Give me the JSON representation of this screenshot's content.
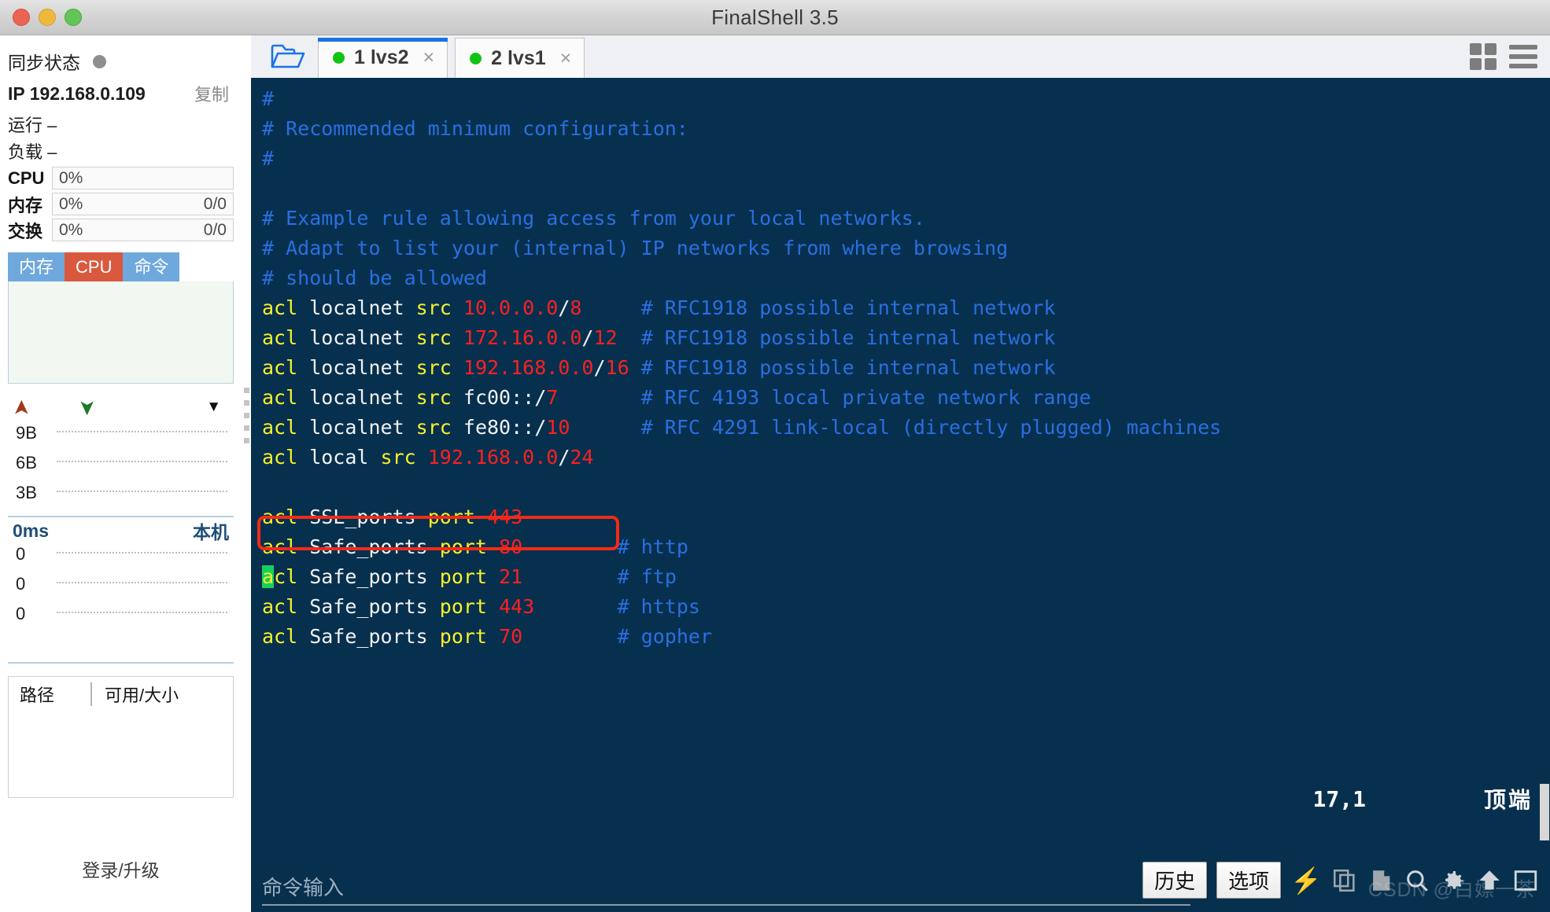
{
  "window": {
    "title": "FinalShell 3.5",
    "traffic_lights": [
      "close",
      "minimize",
      "maximize"
    ]
  },
  "sidebar": {
    "sync_status_label": "同步状态",
    "ip_label": "IP 192.168.0.109",
    "copy_label": "复制",
    "uptime_label": "运行 –",
    "load_label": "负载 –",
    "meters": [
      {
        "name": "CPU",
        "value": "0%",
        "right": ""
      },
      {
        "name": "内存",
        "value": "0%",
        "right": "0/0"
      },
      {
        "name": "交换",
        "value": "0%",
        "right": "0/0"
      }
    ],
    "mini_tabs": [
      {
        "label": "内存",
        "active": false
      },
      {
        "label": "CPU",
        "active": true
      },
      {
        "label": "命令",
        "active": false
      }
    ],
    "net_graph": {
      "upload_icon": "arrow-up",
      "download_icon": "arrow-down",
      "ticks": [
        "9B",
        "6B",
        "3B"
      ]
    },
    "ping_graph": {
      "latency": "0ms",
      "host_label": "本机",
      "ticks": [
        "0",
        "0",
        "0"
      ]
    },
    "disk_panel": {
      "col_path": "路径",
      "col_avail": "可用/大小"
    },
    "login_label": "登录/升级"
  },
  "tabs": {
    "folder_icon": "open-folder-icon",
    "items": [
      {
        "label": "1 lvs2",
        "active": true,
        "status": "connected"
      },
      {
        "label": "2 lvs1",
        "active": false,
        "status": "connected"
      }
    ],
    "close_glyph": "×"
  },
  "top_right": {
    "grid_icon": "grid-view-icon",
    "menu_icon": "hamburger-menu-icon"
  },
  "terminal": {
    "lines": [
      [
        {
          "t": "#",
          "c": "cmt"
        }
      ],
      [
        {
          "t": "# Recommended minimum configuration:",
          "c": "cmt"
        }
      ],
      [
        {
          "t": "#",
          "c": "cmt"
        }
      ],
      [
        {
          "t": "",
          "c": "cmt"
        }
      ],
      [
        {
          "t": "# Example rule allowing access from your local networks.",
          "c": "cmt"
        }
      ],
      [
        {
          "t": "# Adapt to list your (internal) IP networks from where browsing",
          "c": "cmt"
        }
      ],
      [
        {
          "t": "# should be allowed",
          "c": "cmt"
        }
      ],
      [
        {
          "t": "acl",
          "c": "key"
        },
        {
          "t": " localnet ",
          "c": "wht"
        },
        {
          "t": "src",
          "c": "key"
        },
        {
          "t": " ",
          "c": "wht"
        },
        {
          "t": "10.0.0.0",
          "c": "num"
        },
        {
          "t": "/",
          "c": "wht"
        },
        {
          "t": "8",
          "c": "num"
        },
        {
          "t": "     ",
          "c": "wht"
        },
        {
          "t": "# RFC1918 possible internal network",
          "c": "cmt"
        }
      ],
      [
        {
          "t": "acl",
          "c": "key"
        },
        {
          "t": " localnet ",
          "c": "wht"
        },
        {
          "t": "src",
          "c": "key"
        },
        {
          "t": " ",
          "c": "wht"
        },
        {
          "t": "172.16.0.0",
          "c": "num"
        },
        {
          "t": "/",
          "c": "wht"
        },
        {
          "t": "12",
          "c": "num"
        },
        {
          "t": "  ",
          "c": "wht"
        },
        {
          "t": "# RFC1918 possible internal network",
          "c": "cmt"
        }
      ],
      [
        {
          "t": "acl",
          "c": "key"
        },
        {
          "t": " localnet ",
          "c": "wht"
        },
        {
          "t": "src",
          "c": "key"
        },
        {
          "t": " ",
          "c": "wht"
        },
        {
          "t": "192.168.0.0",
          "c": "num"
        },
        {
          "t": "/",
          "c": "wht"
        },
        {
          "t": "16",
          "c": "num"
        },
        {
          "t": " ",
          "c": "wht"
        },
        {
          "t": "# RFC1918 possible internal network",
          "c": "cmt"
        }
      ],
      [
        {
          "t": "acl",
          "c": "key"
        },
        {
          "t": " localnet ",
          "c": "wht"
        },
        {
          "t": "src",
          "c": "key"
        },
        {
          "t": " ",
          "c": "wht"
        },
        {
          "t": "fc00::",
          "c": "wht"
        },
        {
          "t": "/",
          "c": "wht"
        },
        {
          "t": "7",
          "c": "num"
        },
        {
          "t": "       ",
          "c": "wht"
        },
        {
          "t": "# RFC 4193 local private network range",
          "c": "cmt"
        }
      ],
      [
        {
          "t": "acl",
          "c": "key"
        },
        {
          "t": " localnet ",
          "c": "wht"
        },
        {
          "t": "src",
          "c": "key"
        },
        {
          "t": " ",
          "c": "wht"
        },
        {
          "t": "fe80::",
          "c": "wht"
        },
        {
          "t": "/",
          "c": "wht"
        },
        {
          "t": "10",
          "c": "num"
        },
        {
          "t": "      ",
          "c": "wht"
        },
        {
          "t": "# RFC 4291 link-local (directly plugged) machines",
          "c": "cmt"
        }
      ],
      [
        {
          "t": "acl",
          "c": "key"
        },
        {
          "t": " local ",
          "c": "wht"
        },
        {
          "t": "src",
          "c": "key"
        },
        {
          "t": " ",
          "c": "wht"
        },
        {
          "t": "192.168.0.0",
          "c": "num"
        },
        {
          "t": "/",
          "c": "wht"
        },
        {
          "t": "24",
          "c": "num"
        }
      ],
      [
        {
          "t": "",
          "c": "cmt"
        }
      ],
      [
        {
          "t": "acl",
          "c": "key"
        },
        {
          "t": " SSL_ports ",
          "c": "wht"
        },
        {
          "t": "port",
          "c": "key"
        },
        {
          "t": " ",
          "c": "wht"
        },
        {
          "t": "443",
          "c": "num"
        }
      ],
      [
        {
          "t": "acl",
          "c": "key"
        },
        {
          "t": " Safe_ports ",
          "c": "wht"
        },
        {
          "t": "port",
          "c": "key"
        },
        {
          "t": " ",
          "c": "wht"
        },
        {
          "t": "80",
          "c": "num"
        },
        {
          "t": "        ",
          "c": "wht"
        },
        {
          "t": "# http",
          "c": "cmt"
        }
      ],
      [
        {
          "t": "a",
          "c": "cur"
        },
        {
          "t": "cl",
          "c": "key"
        },
        {
          "t": " Safe_ports ",
          "c": "wht"
        },
        {
          "t": "port",
          "c": "key"
        },
        {
          "t": " ",
          "c": "wht"
        },
        {
          "t": "21",
          "c": "num"
        },
        {
          "t": "        ",
          "c": "wht"
        },
        {
          "t": "# ftp",
          "c": "cmt"
        }
      ],
      [
        {
          "t": "acl",
          "c": "key"
        },
        {
          "t": " Safe_ports ",
          "c": "wht"
        },
        {
          "t": "port",
          "c": "key"
        },
        {
          "t": " ",
          "c": "wht"
        },
        {
          "t": "443",
          "c": "num"
        },
        {
          "t": "       ",
          "c": "wht"
        },
        {
          "t": "# https",
          "c": "cmt"
        }
      ],
      [
        {
          "t": "acl",
          "c": "key"
        },
        {
          "t": " Safe_ports ",
          "c": "wht"
        },
        {
          "t": "port",
          "c": "key"
        },
        {
          "t": " ",
          "c": "wht"
        },
        {
          "t": "70",
          "c": "num"
        },
        {
          "t": "        ",
          "c": "wht"
        },
        {
          "t": "# gopher",
          "c": "cmt"
        }
      ]
    ],
    "highlight_note": "red box around: acl local src 192.168.0.0/24",
    "status_position": "17,1",
    "status_scroll": "顶端"
  },
  "bottom_bar": {
    "input_placeholder": "命令输入",
    "history_button": "历史",
    "options_button": "选项",
    "icons": [
      "bolt-icon",
      "copy-icon",
      "paste-icon",
      "search-icon",
      "gear-icon",
      "upload-icon",
      "window-icon"
    ],
    "watermark": "CSDN @白嫖一茶"
  },
  "colors": {
    "terminal_bg": "#07304f",
    "comment": "#2a6fe0",
    "keyword": "#f6f02a",
    "number": "#fb2020",
    "text": "#f2f2f2",
    "cursor": "#15d15c",
    "highlight_box": "#f22a17",
    "tab_active": "#1a73e8",
    "status_green": "#12c412"
  }
}
